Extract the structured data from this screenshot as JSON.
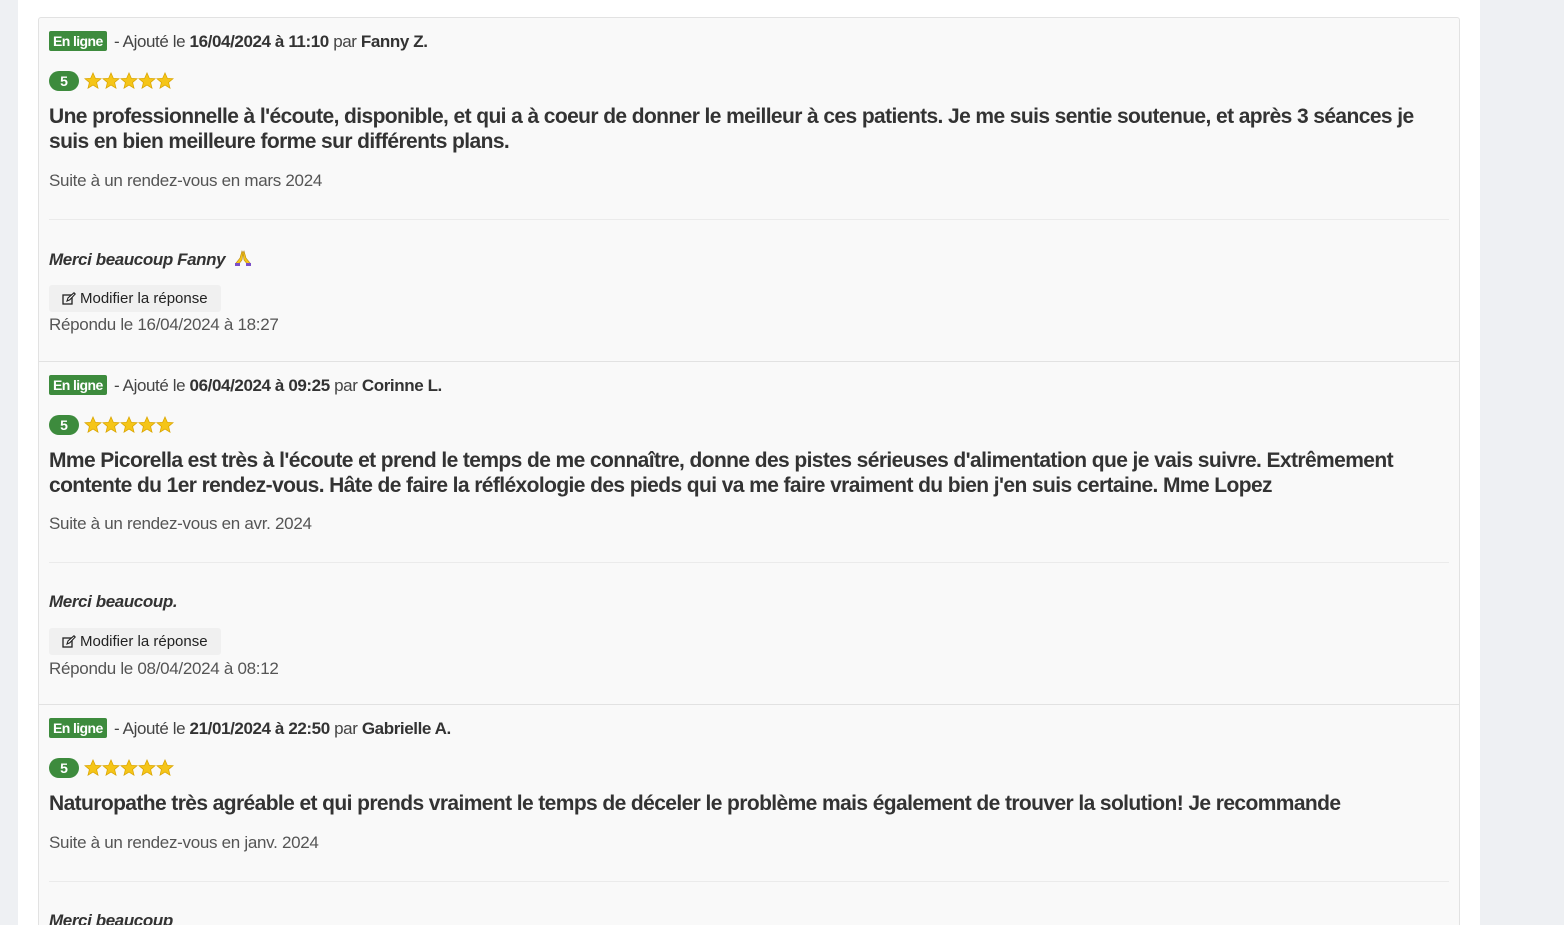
{
  "reviews": [
    {
      "status": "En ligne",
      "added_prefix": "- Ajouté le",
      "date": "16/04/2024 à 11:10",
      "by": "par",
      "author": "Fanny Z.",
      "score": "5",
      "stars": 5,
      "comment": "Une professionnelle à l'écoute, disponible, et qui a à coeur de donner le meilleur à ces patients. Je me suis sentie soutenue, et après 3 séances je suis en bien meilleure forme sur différents plans.",
      "visit": "Suite à un rendez-vous en mars 2024",
      "reply": "Merci beaucoup Fanny",
      "reply_emoji": "praying-hands-icon",
      "edit_label": "Modifier la réponse",
      "answered": "Répondu le 16/04/2024 à 18:27"
    },
    {
      "status": "En ligne",
      "added_prefix": "- Ajouté le",
      "date": "06/04/2024 à 09:25",
      "by": "par",
      "author": "Corinne L.",
      "score": "5",
      "stars": 5,
      "comment": "Mme Picorella est très à l'écoute et prend le temps de me connaître, donne des pistes sérieuses d'alimentation que je vais suivre. Extrêmement contente du 1er rendez-vous. Hâte de faire la réfléxologie des pieds qui va me faire vraiment du bien j'en suis certaine. Mme Lopez",
      "visit": "Suite à un rendez-vous en avr. 2024",
      "reply": "Merci beaucoup.",
      "edit_label": "Modifier la réponse",
      "answered": "Répondu le 08/04/2024 à 08:12"
    },
    {
      "status": "En ligne",
      "added_prefix": "- Ajouté le",
      "date": "21/01/2024 à 22:50",
      "by": "par",
      "author": "Gabrielle A.",
      "score": "5",
      "stars": 5,
      "comment": "Naturopathe très agréable et qui prends vraiment le temps de déceler le problème mais également de trouver la solution! Je recommande",
      "visit": "Suite à un rendez-vous en janv. 2024",
      "reply": "Merci beaucoup"
    }
  ],
  "colors": {
    "badge_green": "#3d8b3d",
    "star_gold": "#f5c518"
  }
}
